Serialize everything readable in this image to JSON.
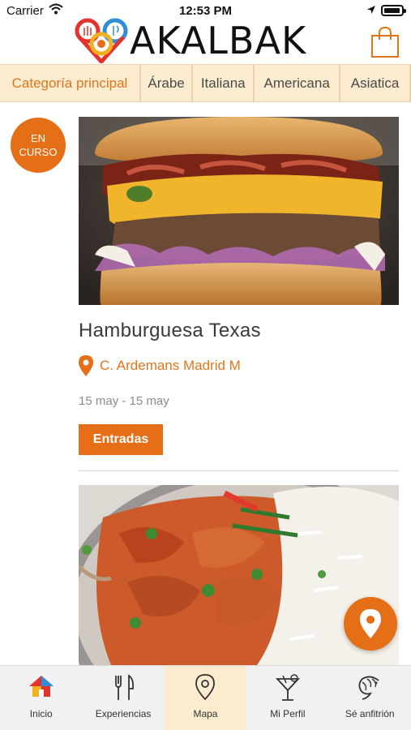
{
  "status_bar": {
    "carrier": "Carrier",
    "time": "12:53 PM"
  },
  "header": {
    "logo_text": "AKALBAK",
    "cart_icon": "shopping-bag-icon"
  },
  "categories": [
    {
      "label": "Categoría principal",
      "active": true
    },
    {
      "label": "Árabe"
    },
    {
      "label": "Italiana"
    },
    {
      "label": "Americana"
    },
    {
      "label": "Asiatica"
    }
  ],
  "colors": {
    "accent": "#e56f17",
    "category_bg": "#fbebcf",
    "text": "#3a3a3a",
    "muted": "#8b8b8b"
  },
  "events": [
    {
      "badge": "EN\nCURSO",
      "image": "burger-photo",
      "title": "Hamburguesa Texas",
      "address": "C. Ardemans Madrid M",
      "dates": "15 may - 15 may",
      "button_label": "Entradas"
    },
    {
      "image": "curry-rice-photo"
    }
  ],
  "tab_bar": [
    {
      "label": "Inicio",
      "icon": "home-icon"
    },
    {
      "label": "Experiencias",
      "icon": "cutlery-icon"
    },
    {
      "label": "Mapa",
      "icon": "map-pin-icon",
      "active": true
    },
    {
      "label": "Mi Perfil",
      "icon": "cocktail-icon"
    },
    {
      "label": "Sé anfitrión",
      "icon": "shrimp-icon"
    }
  ]
}
